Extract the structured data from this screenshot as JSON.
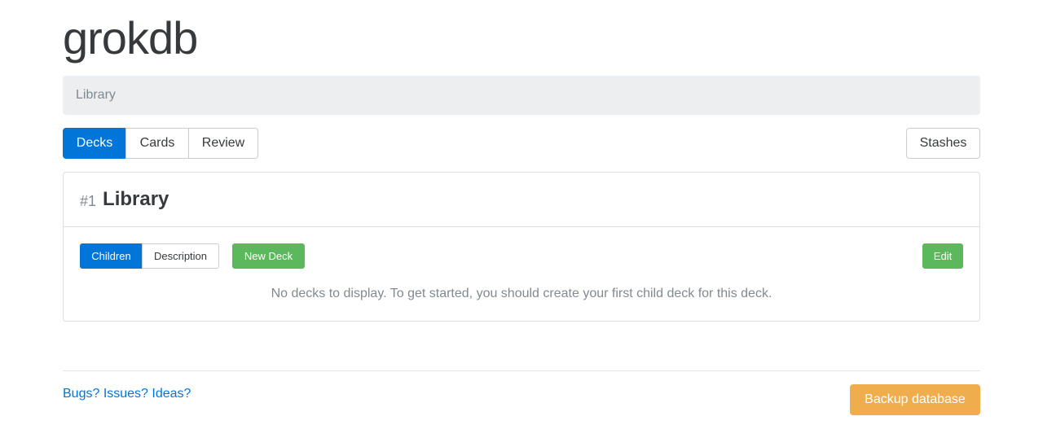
{
  "header": {
    "app_title": "grokdb"
  },
  "breadcrumb": {
    "items": [
      "Library"
    ]
  },
  "tabs": [
    {
      "label": "Decks",
      "active": true
    },
    {
      "label": "Cards",
      "active": false
    },
    {
      "label": "Review",
      "active": false
    }
  ],
  "stashes_label": "Stashes",
  "deck": {
    "number": "#1",
    "title": "Library",
    "subtabs": [
      {
        "label": "Children",
        "active": true
      },
      {
        "label": "Description",
        "active": false
      }
    ],
    "new_deck_label": "New Deck",
    "edit_label": "Edit",
    "empty_message": "No decks to display. To get started, you should create your first child deck for this deck."
  },
  "footer": {
    "feedback_link": "Bugs? Issues? Ideas?",
    "backup_label": "Backup database"
  },
  "colors": {
    "primary": "#0275d8",
    "success": "#5cb85c",
    "warning": "#f0ad4e",
    "muted": "#818a91"
  }
}
